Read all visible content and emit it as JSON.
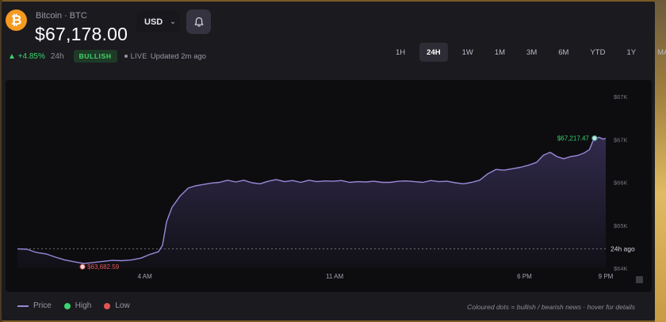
{
  "coin": {
    "symbol_glyph": "₿",
    "name": "Bitcoin · BTC",
    "price": "$67,178.00",
    "change": "▲ +4.85%",
    "period": "24h",
    "sentiment": "BULLISH",
    "live": "LIVE",
    "updated": "Updated 2m ago"
  },
  "currency": {
    "value": "USD",
    "chevron": "⌄"
  },
  "tabs": [
    {
      "label": "1H",
      "active": false
    },
    {
      "label": "24H",
      "active": true
    },
    {
      "label": "1W",
      "active": false
    },
    {
      "label": "1M",
      "active": false
    },
    {
      "label": "3M",
      "active": false
    },
    {
      "label": "6M",
      "active": false
    },
    {
      "label": "YTD",
      "active": false
    },
    {
      "label": "1Y",
      "active": false
    },
    {
      "label": "MAX",
      "active": false
    }
  ],
  "legend": {
    "price": "Price",
    "high": "High",
    "low": "Low"
  },
  "footnote": "Coloured dots = bullish / bearish news · hover for details",
  "colors": {
    "line": "#9a88d8",
    "high": "#3ad46f",
    "low": "#e25555",
    "bullish_bg": "#1d3b27",
    "accent_orange": "#f39a1f"
  },
  "icons": {
    "coin": "bitcoin-icon",
    "bell": "bell-icon",
    "chevron": "chevron-down-icon",
    "expand": "expand-icon"
  },
  "chart_data": {
    "type": "area",
    "y_unit": "USD",
    "x_ticks": [
      "4 AM",
      "11 AM",
      "6 PM",
      "9 PM"
    ],
    "x_tick_positions_h": [
      4,
      11,
      18,
      21
    ],
    "x_range_h": [
      -0.7,
      21
    ],
    "y_ticks": [
      "$67K",
      "$67K",
      "$66K",
      "$65K",
      "$64K"
    ],
    "y_tick_values": [
      67800,
      67200,
      66600,
      66000,
      65400
    ],
    "ylim": [
      65400,
      67800
    ],
    "reference": {
      "label": "24h ago",
      "value": 65670
    },
    "high_label": "$67,217.47",
    "high": {
      "h": 20.5,
      "value": 67217.47
    },
    "low_label": "$63,682.59",
    "low": {
      "h": 1.7,
      "value": 63682.59
    },
    "series": [
      {
        "points": [
          [
            -0.7,
            65670
          ],
          [
            -0.35,
            65665
          ],
          [
            0.0,
            65620
          ],
          [
            0.35,
            65600
          ],
          [
            0.7,
            65555
          ],
          [
            1.05,
            65515
          ],
          [
            1.4,
            65490
          ],
          [
            1.75,
            65465
          ],
          [
            2.1,
            65480
          ],
          [
            2.45,
            65495
          ],
          [
            2.8,
            65510
          ],
          [
            3.15,
            65505
          ],
          [
            3.5,
            65515
          ],
          [
            3.85,
            65540
          ],
          [
            4.2,
            65595
          ],
          [
            4.5,
            65630
          ],
          [
            4.65,
            65720
          ],
          [
            4.8,
            66050
          ],
          [
            5.0,
            66250
          ],
          [
            5.3,
            66410
          ],
          [
            5.6,
            66520
          ],
          [
            5.85,
            66550
          ],
          [
            6.15,
            66570
          ],
          [
            6.45,
            66590
          ],
          [
            6.75,
            66600
          ],
          [
            7.05,
            66630
          ],
          [
            7.35,
            66605
          ],
          [
            7.65,
            66630
          ],
          [
            7.95,
            66595
          ],
          [
            8.25,
            66580
          ],
          [
            8.55,
            66615
          ],
          [
            8.85,
            66640
          ],
          [
            9.15,
            66610
          ],
          [
            9.45,
            66625
          ],
          [
            9.75,
            66600
          ],
          [
            10.05,
            66630
          ],
          [
            10.35,
            66610
          ],
          [
            10.65,
            66620
          ],
          [
            10.95,
            66615
          ],
          [
            11.25,
            66625
          ],
          [
            11.55,
            66600
          ],
          [
            11.85,
            66610
          ],
          [
            12.15,
            66605
          ],
          [
            12.45,
            66615
          ],
          [
            12.75,
            66600
          ],
          [
            13.05,
            66600
          ],
          [
            13.35,
            66615
          ],
          [
            13.65,
            66620
          ],
          [
            13.95,
            66610
          ],
          [
            14.25,
            66600
          ],
          [
            14.55,
            66625
          ],
          [
            14.85,
            66610
          ],
          [
            15.15,
            66615
          ],
          [
            15.45,
            66595
          ],
          [
            15.75,
            66580
          ],
          [
            16.05,
            66600
          ],
          [
            16.35,
            66630
          ],
          [
            16.65,
            66720
          ],
          [
            16.95,
            66780
          ],
          [
            17.25,
            66770
          ],
          [
            17.55,
            66790
          ],
          [
            17.85,
            66810
          ],
          [
            18.15,
            66840
          ],
          [
            18.45,
            66880
          ],
          [
            18.7,
            66980
          ],
          [
            18.95,
            67020
          ],
          [
            19.2,
            66960
          ],
          [
            19.45,
            66930
          ],
          [
            19.7,
            66960
          ],
          [
            19.95,
            66975
          ],
          [
            20.2,
            67010
          ],
          [
            20.4,
            67060
          ],
          [
            20.55,
            67200
          ],
          [
            20.75,
            67230
          ],
          [
            20.9,
            67205
          ],
          [
            21.0,
            67215
          ]
        ]
      }
    ]
  }
}
